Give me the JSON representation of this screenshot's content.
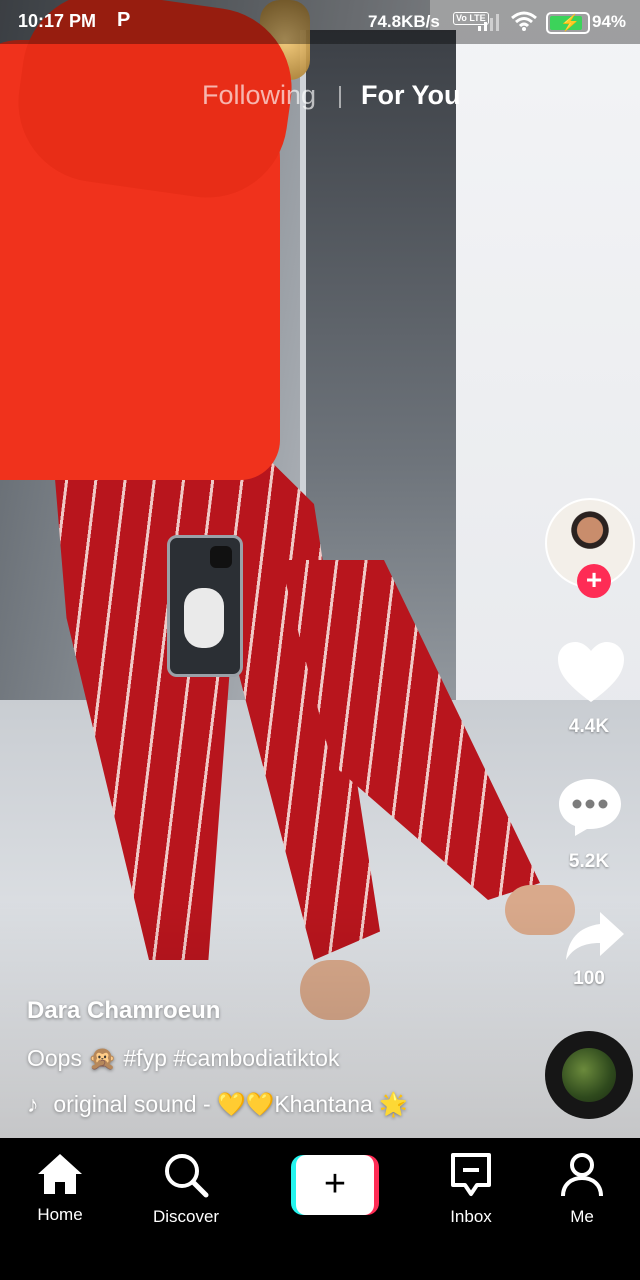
{
  "status_bar": {
    "time": "10:17 PM",
    "app_icon": "P",
    "net_speed": "74.8KB/s",
    "volte": "Vo LTE",
    "battery_pct": "94%",
    "battery_level": 0.94
  },
  "tabs": {
    "following": "Following",
    "for_you": "For You",
    "active": "For You"
  },
  "rail": {
    "follow_symbol": "+",
    "likes": "4.4K",
    "comments": "5.2K",
    "shares": "100"
  },
  "caption": {
    "author": "Dara Chamroeun",
    "text": "Oops 🙊 #fyp #cambodiatiktok",
    "sound": "original sound - 💛💛Khantana 🌟"
  },
  "nav": {
    "home": "Home",
    "discover": "Discover",
    "create_symbol": "+",
    "inbox": "Inbox",
    "me": "Me"
  },
  "colors": {
    "accent": "#fe2c55",
    "cyan": "#25f4ee",
    "battery": "#3cd35a"
  },
  "icons": [
    "home-icon",
    "search-icon",
    "plus-icon",
    "inbox-icon",
    "person-icon",
    "heart-icon",
    "comment-icon",
    "share-icon",
    "music-note-icon"
  ]
}
